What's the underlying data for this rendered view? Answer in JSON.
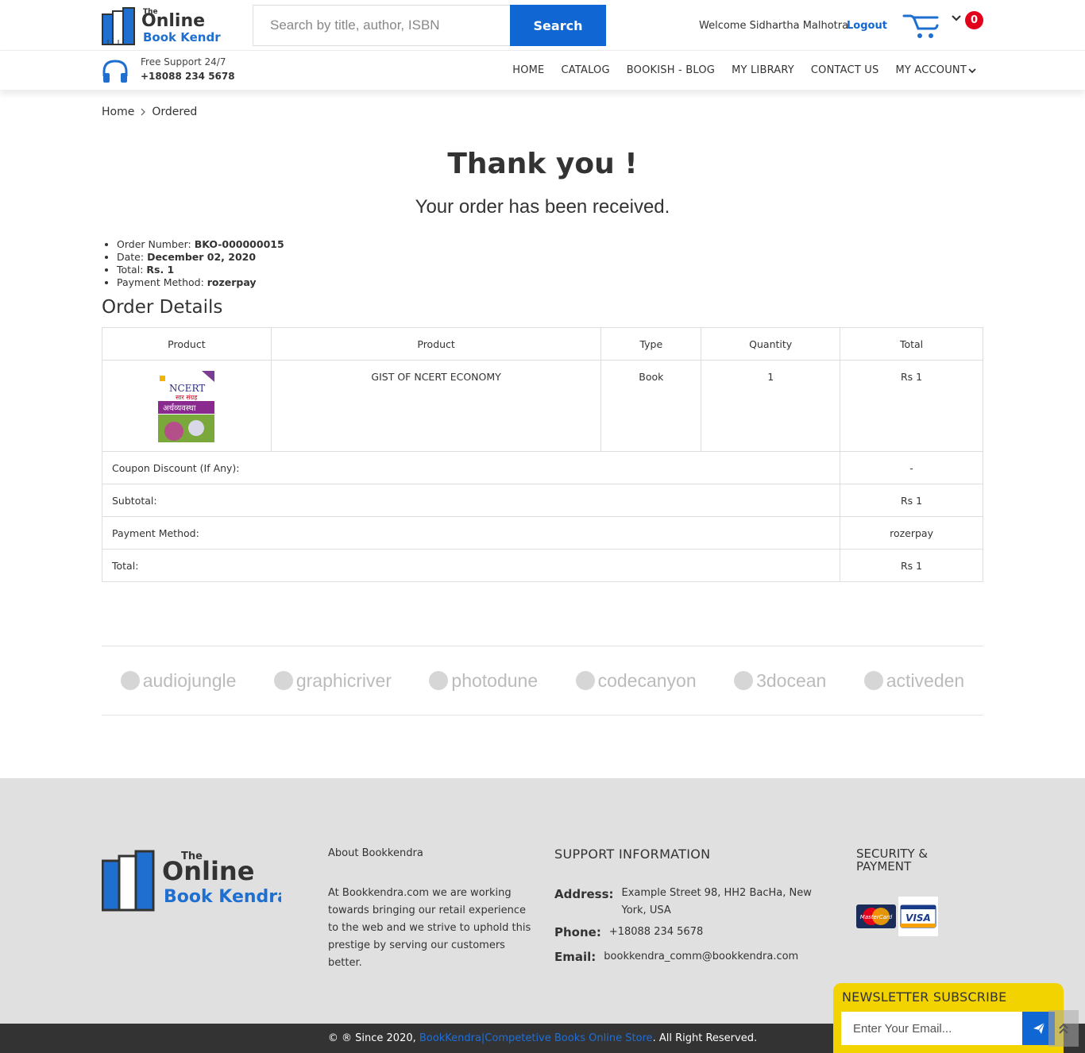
{
  "header": {
    "logo_top": "The",
    "logo_mid": "Online",
    "logo_bottom": "Book Kendra",
    "search_placeholder": "Search by title, author, ISBN",
    "search_button": "Search",
    "welcome": "Welcome Sidhartha Malhotra",
    "logout": "Logout",
    "cart_count": "0"
  },
  "support": {
    "label": "Free Support 24/7",
    "phone": "+18088 234 5678"
  },
  "nav": {
    "home": "HOME",
    "catalog": "CATALOG",
    "blog": "BOOKISH - BLOG",
    "library": "MY LIBRARY",
    "contact": "CONTACT US",
    "account": "MY ACCOUNT"
  },
  "breadcrumb": {
    "home": "Home",
    "current": "Ordered"
  },
  "confirmation": {
    "title": "Thank you !",
    "subtitle": "Your order has been received."
  },
  "summary": {
    "order_number_label": "Order Number: ",
    "order_number": "BKO-000000015",
    "date_label": "Date: ",
    "date": "December 02, 2020",
    "total_label": "Total: ",
    "total": "Rs. 1",
    "payment_label": "Payment Method: ",
    "payment": "rozerpay"
  },
  "order_details": {
    "title": "Order Details",
    "headers": [
      "Product",
      "Product",
      "Type",
      "Quantity",
      "Total"
    ],
    "item": {
      "name": "GIST OF NCERT ECONOMY",
      "type": "Book",
      "quantity": "1",
      "total": "Rs 1",
      "cover_title": "NCERT",
      "cover_sub": "सार संग्रह",
      "cover_main": "अर्थव्यवस्था"
    },
    "rows": [
      {
        "label": "Coupon Discount (If Any):",
        "value": "-"
      },
      {
        "label": "Subtotal:",
        "value": "Rs 1"
      },
      {
        "label": "Payment Method:",
        "value": "rozerpay"
      },
      {
        "label": "Total:",
        "value": "Rs 1"
      }
    ]
  },
  "brands": [
    "audiojungle",
    "graphicriver",
    "photodune",
    "codecanyon",
    "3docean",
    "activeden"
  ],
  "footer": {
    "about_title": "About Bookkendra",
    "about_text": "At Bookkendra.com we are working towards bringing our retail experience to the web and we strive to uphold this prestige by serving our customers better.",
    "support_title": "SUPPORT INFORMATION",
    "address_label": "Address:",
    "address": "Example Street 98, HH2 BacHa, New York, USA",
    "phone_label": "Phone:",
    "phone": "+18088 234 5678",
    "email_label": "Email:",
    "email": "bookkendra_comm@bookkendra.com",
    "security_title": "SECURITY & PAYMENT",
    "mastercard": "MasterCard",
    "visa": "VISA"
  },
  "copyright": {
    "prefix": "© ® Since 2020, ",
    "link": "BookKendra|Competetive Books Online Store",
    "suffix": ". All Right Reserved."
  },
  "newsletter": {
    "title": "NEWSLETTER SUBSCRIBE",
    "placeholder": "Enter Your Email..."
  },
  "colors": {
    "brand_blue": "#1067d3",
    "badge_red": "#e3001b",
    "newsletter_yellow": "#f2d300",
    "footer_bg": "#e0e0e0",
    "bottom_bar": "#333333"
  }
}
